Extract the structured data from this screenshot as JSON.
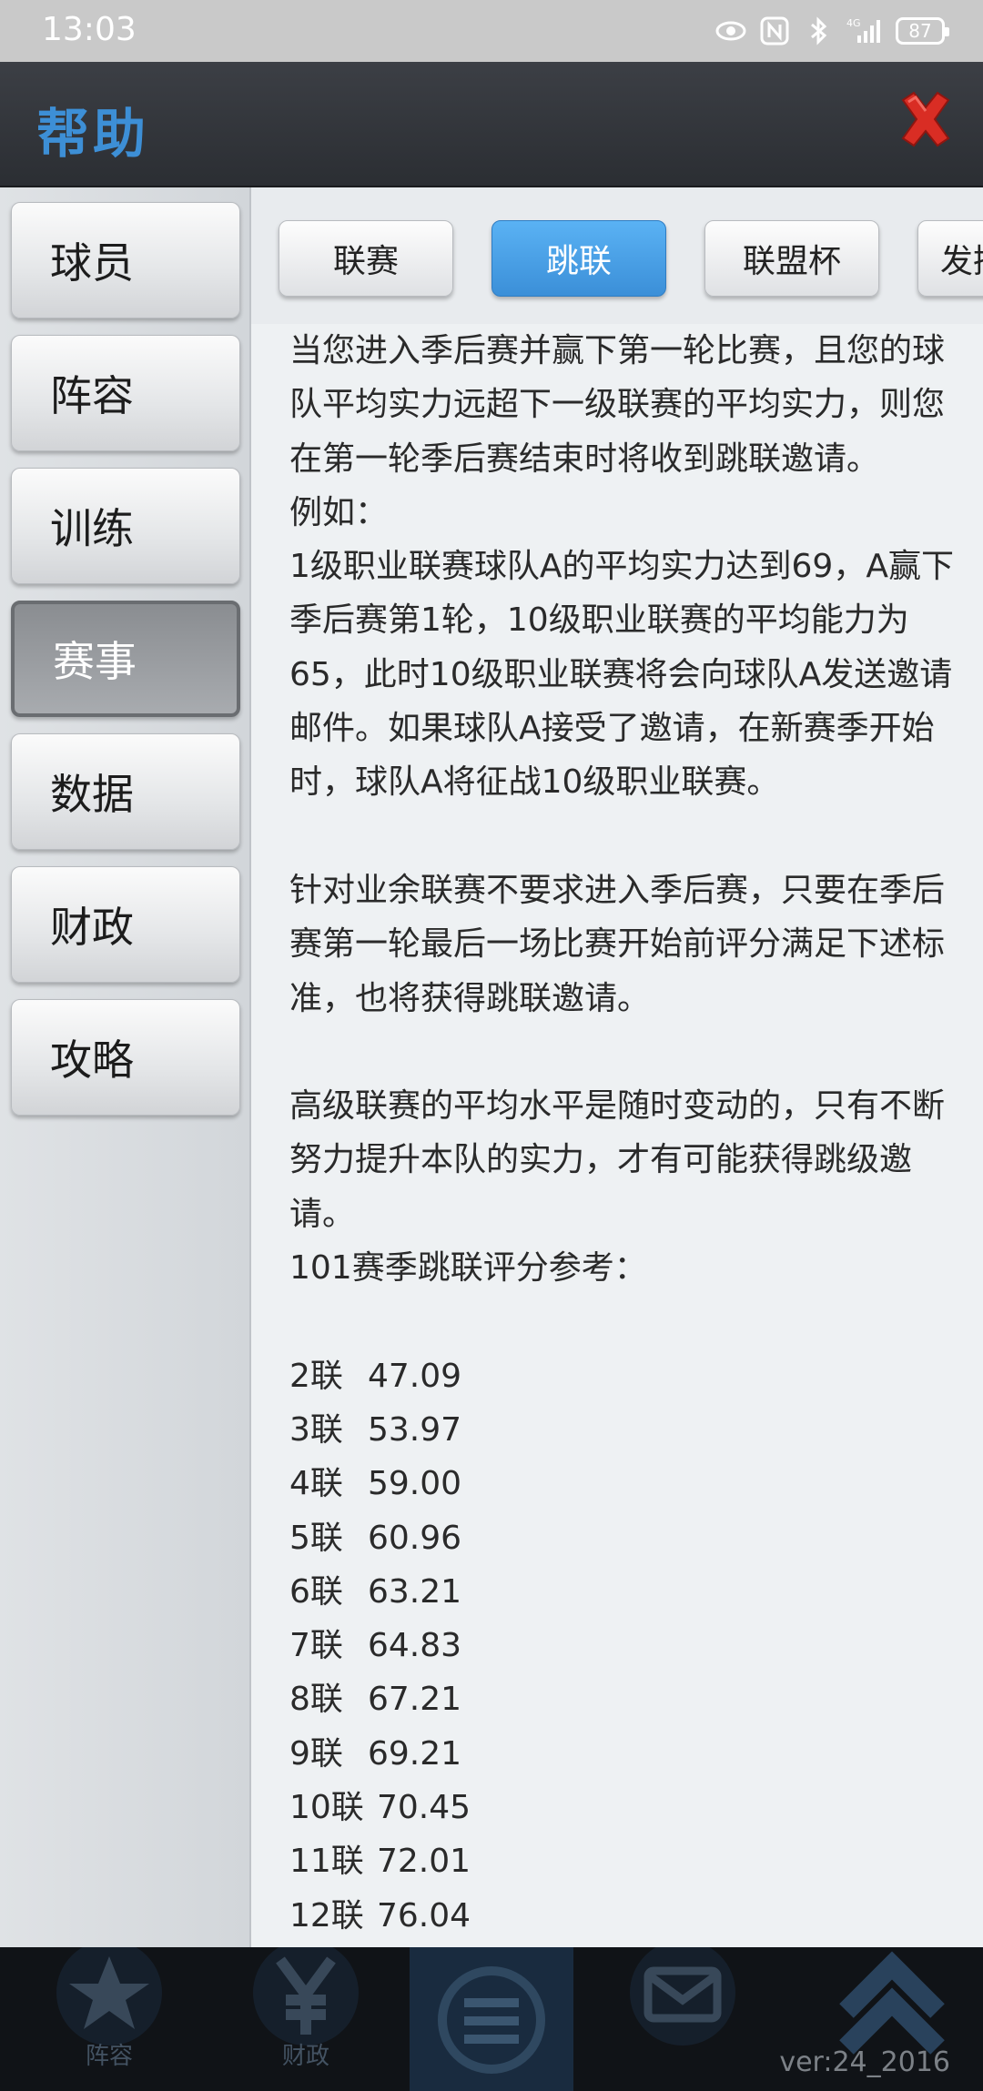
{
  "status_bar": {
    "time": "13:03",
    "network": "4G",
    "battery": "87",
    "icons": [
      "eye-icon",
      "nfc-icon",
      "bluetooth-icon",
      "signal-icon",
      "battery-icon"
    ]
  },
  "header": {
    "title": "帮助",
    "close_icon": "close-icon",
    "title_color": "#3d8fd6",
    "close_color": "#d92d24"
  },
  "sidebar": {
    "items": [
      {
        "label": "球员"
      },
      {
        "label": "阵容"
      },
      {
        "label": "训练"
      },
      {
        "label": "赛事",
        "active": true
      },
      {
        "label": "数据"
      },
      {
        "label": "财政"
      },
      {
        "label": "攻略"
      }
    ]
  },
  "tabs": [
    {
      "label": "联赛"
    },
    {
      "label": "跳联",
      "active": true
    },
    {
      "label": "联盟杯"
    },
    {
      "label": "发挥"
    }
  ],
  "article": {
    "paragraph1": "当您进入季后赛并赢下第一轮比赛，且您的球队平均实力远超下一级联赛的平均实力，则您在第一轮季后赛结束时将收到跳联邀请。",
    "example_label": "例如：",
    "example_text": "1级职业联赛球队A的平均实力达到69，A赢下季后赛第1轮，10级职业联赛的平均能力为65，此时10级职业联赛将会向球队A发送邀请邮件。如果球队A接受了邀请，在新赛季开始时，球队A将征战10级职业联赛。",
    "paragraph2": "针对业余联赛不要求进入季后赛，只要在季后赛第一轮最后一场比赛开始前评分满足下述标准，也将获得跳联邀请。",
    "paragraph3": "高级联赛的平均水平是随时变动的，只有不断努力提升本队的实力，才有可能获得跳级邀请。",
    "scores_title": "101赛季跳联评分参考：",
    "scores": [
      {
        "league": "2联",
        "score": "47.09"
      },
      {
        "league": "3联",
        "score": "53.97"
      },
      {
        "league": "4联",
        "score": "59.00"
      },
      {
        "league": "5联",
        "score": "60.96"
      },
      {
        "league": "6联",
        "score": "63.21"
      },
      {
        "league": "7联",
        "score": "64.83"
      },
      {
        "league": "8联",
        "score": "67.21"
      },
      {
        "league": "9联",
        "score": "69.21"
      },
      {
        "league": "10联",
        "score": "70.45"
      },
      {
        "league": "11联",
        "score": "72.01"
      },
      {
        "league": "12联",
        "score": "76.04"
      }
    ]
  },
  "bottom_nav": {
    "items": [
      {
        "label": "阵容",
        "icon": "star-icon"
      },
      {
        "label": "财政",
        "icon": "yen-icon"
      },
      {
        "label": "",
        "icon": "menu-icon"
      },
      {
        "label": "",
        "icon": "mail-icon"
      },
      {
        "label": "",
        "icon": "arrow-up-icon"
      }
    ],
    "version": "ver:24_2016"
  }
}
